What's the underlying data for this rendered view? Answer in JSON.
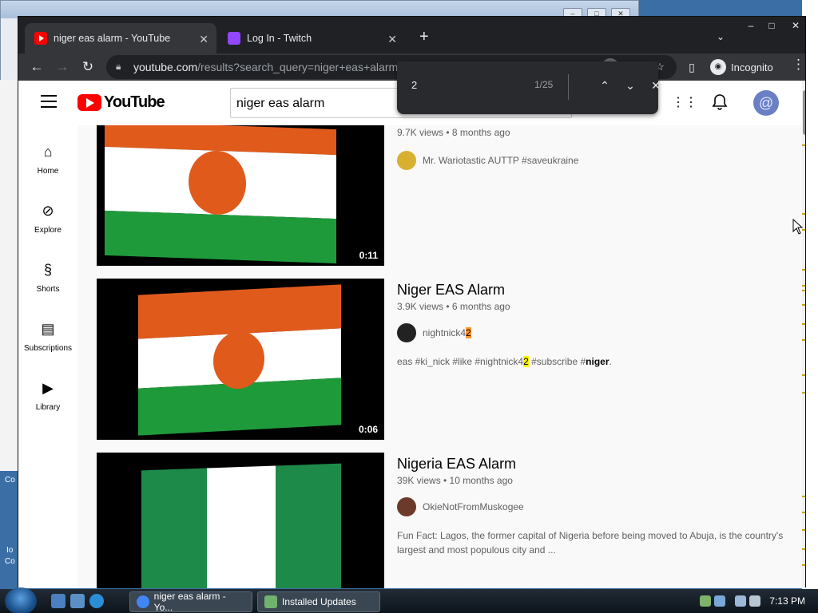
{
  "desktop": {
    "bg_window_controls": [
      "–",
      "□",
      "✕"
    ],
    "left_labels": [
      "Co",
      "Io",
      "Co"
    ]
  },
  "browser": {
    "tabs": [
      {
        "label": "niger eas alarm - YouTube",
        "icon": "youtube-icon",
        "active": true
      },
      {
        "label": "Log In - Twitch",
        "icon": "twitch-icon",
        "active": false
      }
    ],
    "new_tab": "+",
    "window_controls": [
      "–",
      "□",
      "✕"
    ],
    "url_domain": "youtube.com",
    "url_rest": "/results?search_query=niger+eas+alarm",
    "incognito_label": "Incognito",
    "find": {
      "query": "2",
      "count": "1/25"
    }
  },
  "youtube": {
    "logo_text": "YouTube",
    "search_value": "niger eas alarm",
    "guide": [
      {
        "label": "Home",
        "icon": "home-icon"
      },
      {
        "label": "Explore",
        "icon": "compass-icon"
      },
      {
        "label": "Shorts",
        "icon": "shorts-icon"
      },
      {
        "label": "Subscriptions",
        "icon": "subscriptions-icon"
      },
      {
        "label": "Library",
        "icon": "library-icon"
      }
    ],
    "results": [
      {
        "title": "",
        "meta": "9.7K views • 8 months ago",
        "channel": "Mr. Wariotastic AUTTP #saveukraine",
        "duration": "0:11"
      },
      {
        "title": "Niger EAS Alarm",
        "meta": "3.9K views • 6 months ago",
        "channel_prefix": "nightnick4",
        "channel_match": "2",
        "duration": "0:06",
        "desc": {
          "a": "eas #ki_nick #like #nightnick4",
          "match": "2",
          "b": " #subscribe #",
          "bold": "niger",
          "c": "."
        }
      },
      {
        "title": "Nigeria EAS Alarm",
        "meta": "39K views • 10 months ago",
        "channel": "OkieNotFromMuskogee",
        "desc_line1": "Fun Fact: Lagos, the former capital of Nigeria before being moved to Abuja, is the country's",
        "desc_line2": "largest and most populous city and ..."
      }
    ]
  },
  "taskbar": {
    "tasks": [
      {
        "label": "niger eas alarm - Yo...",
        "icon": "chrome-icon"
      },
      {
        "label": "Installed Updates",
        "icon": "updates-icon"
      }
    ],
    "clock": "7:13 PM"
  },
  "colors": {
    "youtube_red": "#ff0000",
    "niger_orange": "#e05a1c",
    "niger_green": "#1f9a3a",
    "nigeria_green": "#1e8a4a",
    "find_highlight": "#fff200",
    "find_current": "#ff9632"
  }
}
